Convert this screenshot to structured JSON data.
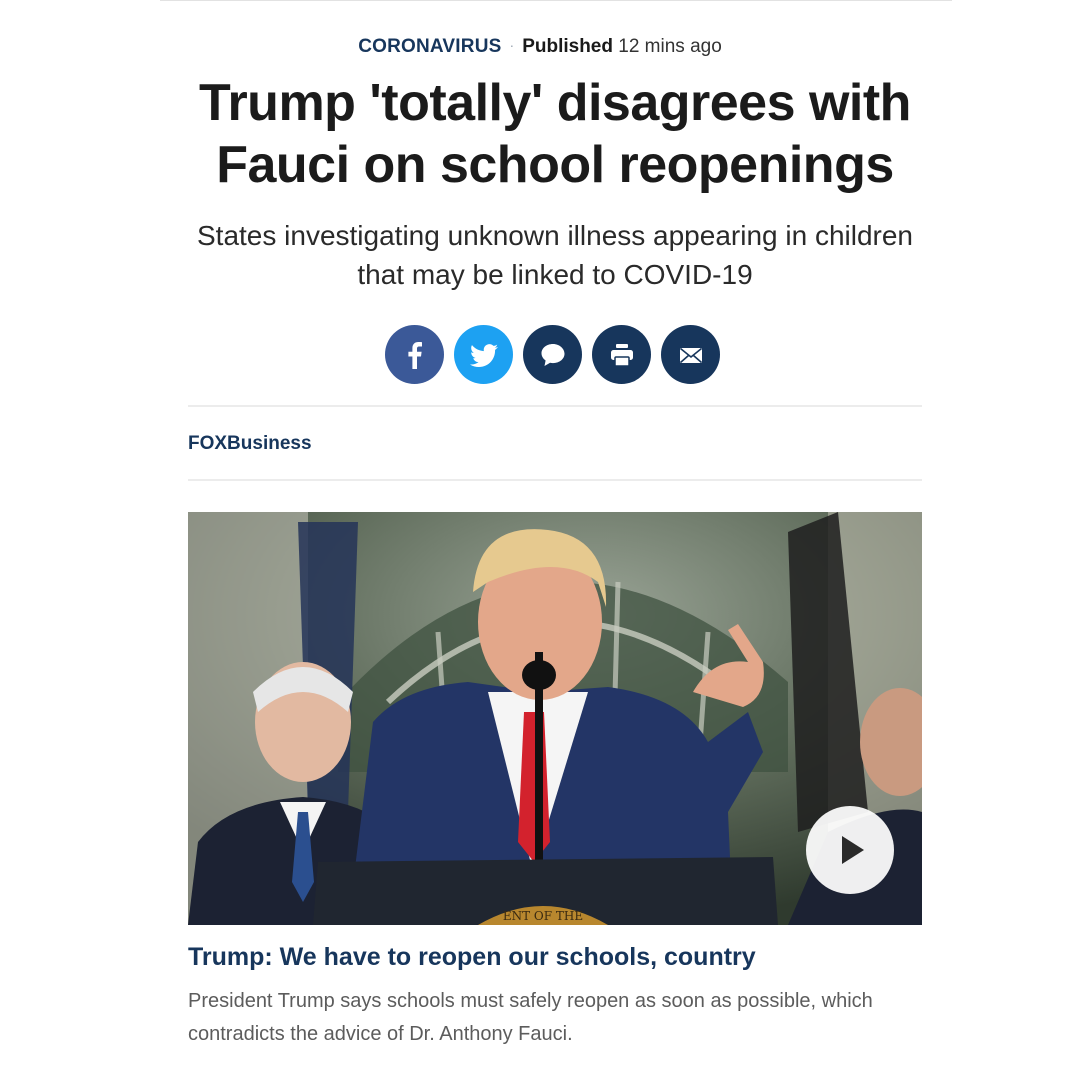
{
  "meta": {
    "category": "CORONAVIRUS",
    "separator": "·",
    "published_label": "Published",
    "published_time": "12 mins ago"
  },
  "article": {
    "headline": "Trump 'totally' disagrees with Fauci on school reopenings",
    "subheadline": "States investigating unknown illness appearing in children that may be linked to COVID-19"
  },
  "share": {
    "buttons": [
      {
        "icon": "facebook-icon",
        "color": "#3b5998"
      },
      {
        "icon": "twitter-icon",
        "color": "#1da1f2"
      },
      {
        "icon": "comment-icon",
        "color": "#17365c"
      },
      {
        "icon": "print-icon",
        "color": "#17365c"
      },
      {
        "icon": "email-icon",
        "color": "#17365c"
      }
    ]
  },
  "source": {
    "label": "FOXBusiness"
  },
  "video": {
    "seal_text": "ENT OF THE",
    "title": "Trump: We have to reopen our schools, country",
    "description": "President Trump says schools must safely reopen as soon as possible, which contradicts the advice of Dr. Anthony Fauci."
  },
  "colors": {
    "brand_navy": "#17365c",
    "headline": "#1b1b1b",
    "body_gray": "#5c5c5c"
  }
}
